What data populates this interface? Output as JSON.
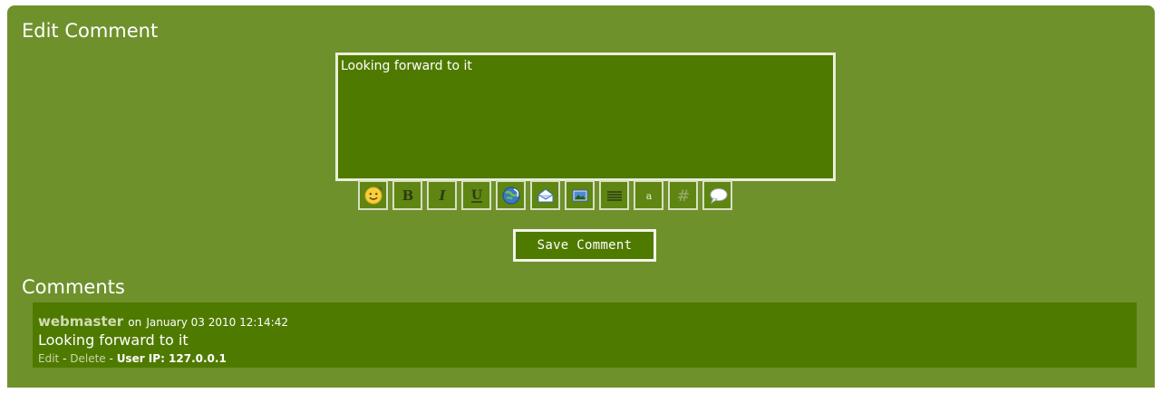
{
  "edit": {
    "title": "Edit Comment",
    "textarea_value": "Looking forward to it",
    "save_label": "Save Comment"
  },
  "toolbar": {
    "buttons": [
      {
        "name": "smiley-icon",
        "glyph": "😊"
      },
      {
        "name": "bold-icon",
        "glyph": "B"
      },
      {
        "name": "italic-icon",
        "glyph": "I"
      },
      {
        "name": "underline-icon",
        "glyph": "U"
      },
      {
        "name": "link-icon",
        "glyph": "🌐"
      },
      {
        "name": "email-icon",
        "glyph": "✉"
      },
      {
        "name": "image-icon",
        "glyph": "🖼"
      },
      {
        "name": "center-align-icon",
        "glyph": "≡"
      },
      {
        "name": "small-text-icon",
        "glyph": "a"
      },
      {
        "name": "code-icon",
        "glyph": "#"
      },
      {
        "name": "quote-icon",
        "glyph": "💬"
      }
    ]
  },
  "comments": {
    "title": "Comments",
    "items": [
      {
        "author": "webmaster",
        "on_label": "on",
        "date": "January 03 2010 12:14:42",
        "text": "Looking forward to it",
        "edit_label": "Edit",
        "separator": "-",
        "delete_label": "Delete",
        "ip_label": "User IP: 127.0.0.1"
      }
    ]
  },
  "colors": {
    "panel_bg": "#6f912c",
    "dark_bg": "#4f7a00",
    "border": "#e9eed9"
  }
}
